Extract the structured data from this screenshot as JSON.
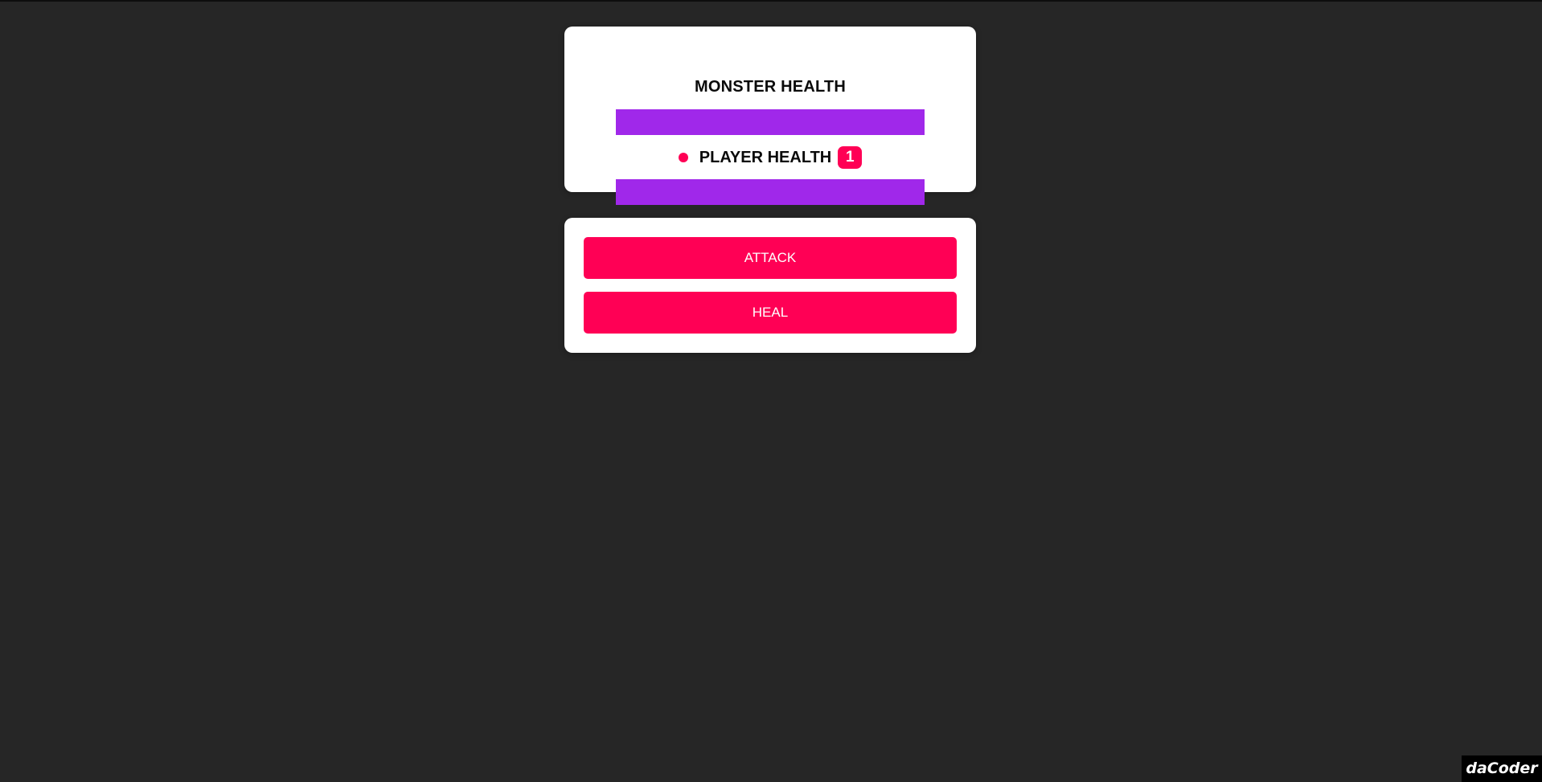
{
  "game": {
    "monster_health_label": "MONSTER HEALTH",
    "monster_health_percent": 100,
    "player_health_label": "PLAYER HEALTH",
    "player_health_percent": 100,
    "round_counter": "1",
    "turn_indicator_color": "#ff0055"
  },
  "controls": {
    "attack_label": "ATTACK",
    "heal_label": "HEAL"
  },
  "colors": {
    "background": "#262626",
    "health_fill": "#a028ea",
    "accent": "#ff0055",
    "card": "#ffffff"
  },
  "brand": {
    "label": "daCoder"
  }
}
